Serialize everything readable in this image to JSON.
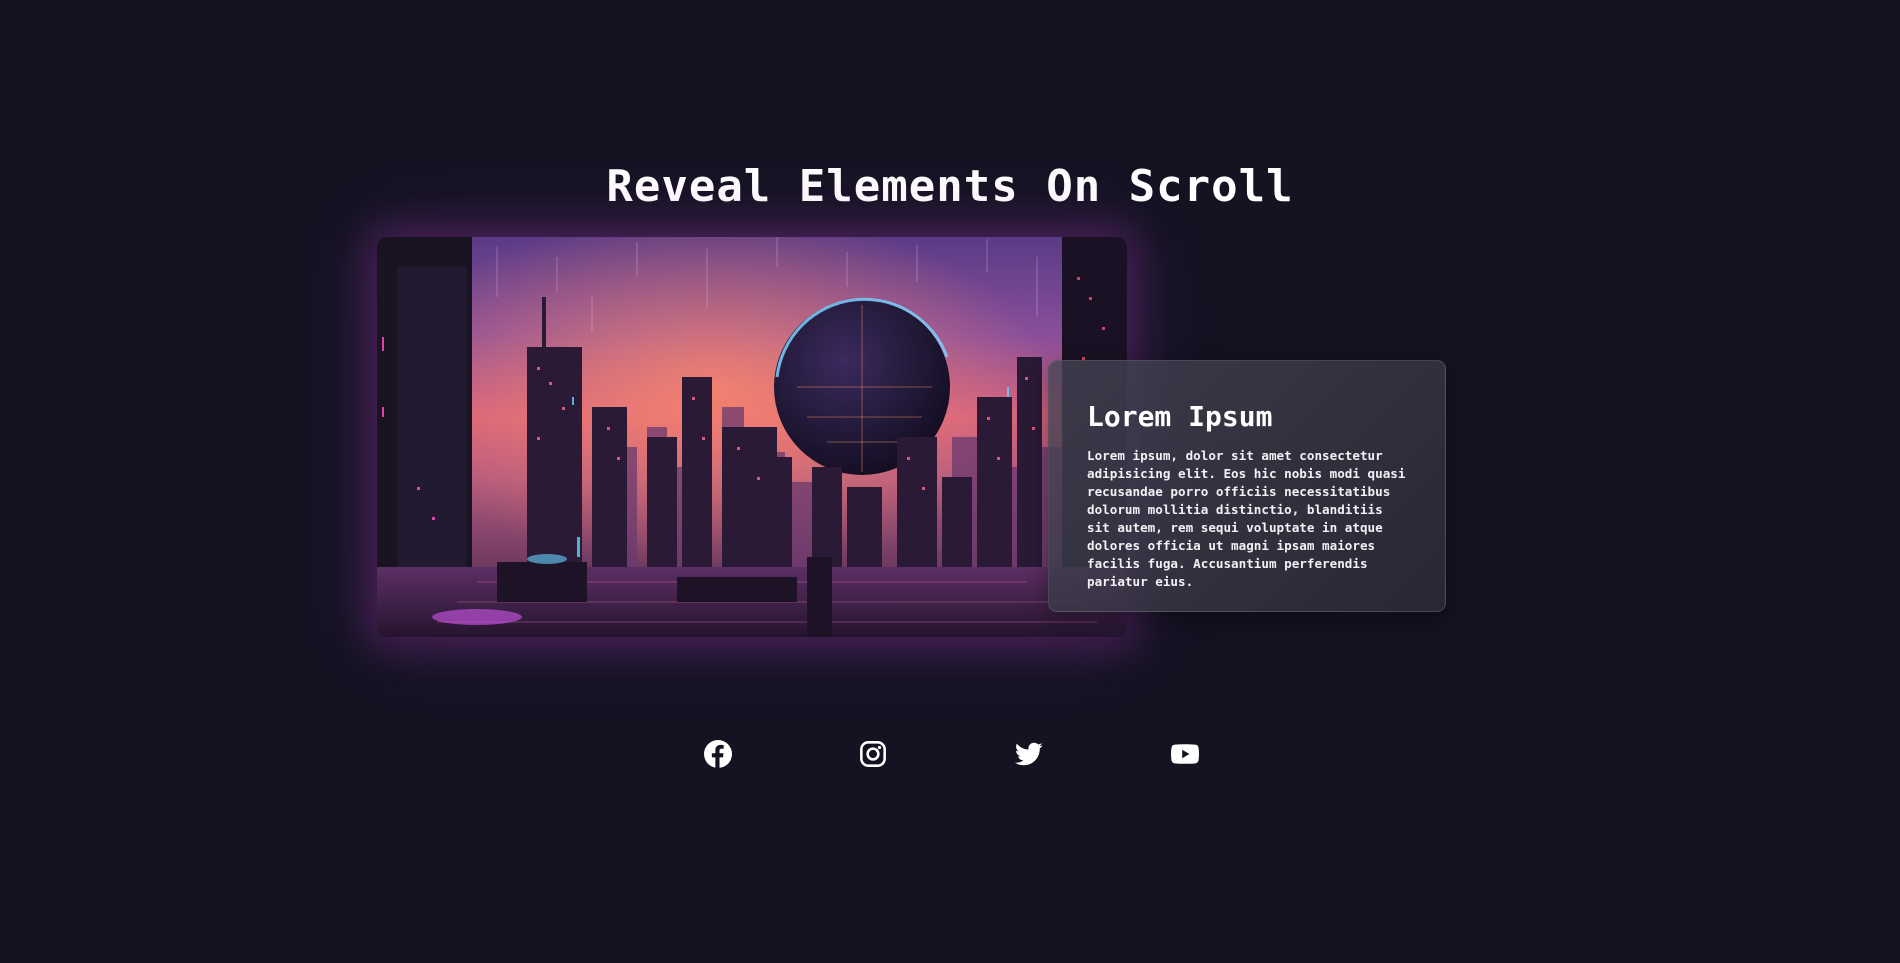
{
  "page": {
    "title": "Reveal Elements On Scroll"
  },
  "card": {
    "title": "Lorem Ipsum",
    "body": "Lorem ipsum, dolor sit amet consectetur adipisicing elit. Eos hic nobis modi quasi recusandae porro officiis necessitatibus dolorum mollitia distinctio, blanditiis sit autem, rem sequi voluptate in atque dolores officia ut magni ipsam maiores facilis fuga. Accusantium perferendis pariatur eius."
  },
  "hero": {
    "image_subject": "cyberpunk city skyline with glowing sphere"
  },
  "socials": [
    {
      "icon": "facebook-icon"
    },
    {
      "icon": "instagram-icon"
    },
    {
      "icon": "twitter-icon"
    },
    {
      "icon": "youtube-icon"
    }
  ],
  "colors": {
    "background": "#131321",
    "text": "#ffffff",
    "accent_glow": "#be46c8",
    "card": "#3a3a48"
  }
}
